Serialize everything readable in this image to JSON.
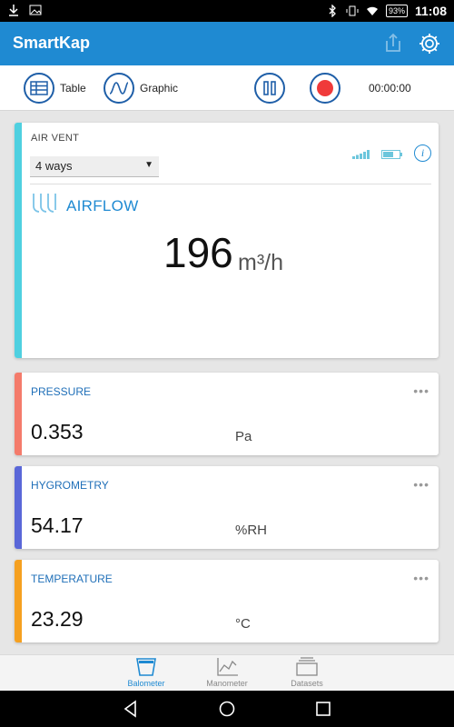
{
  "status_bar": {
    "battery": "93%",
    "time": "11:08"
  },
  "app": {
    "title": "SmartKap"
  },
  "toolbar": {
    "table_label": "Table",
    "graphic_label": "Graphic",
    "timer": "00:00:00"
  },
  "main_card": {
    "label": "AIR VENT",
    "selected_option": "4 ways",
    "measure_label": "AIRFLOW",
    "value": "196",
    "unit": "m³/h",
    "accent_color": "#4fd0e0"
  },
  "sensors": [
    {
      "title": "PRESSURE",
      "value": "0.353",
      "unit": "Pa",
      "accent_color": "#f47b6b"
    },
    {
      "title": "HYGROMETRY",
      "value": "54.17",
      "unit": "%RH",
      "accent_color": "#5a67d8"
    },
    {
      "title": "TEMPERATURE",
      "value": "23.29",
      "unit": "°C",
      "accent_color": "#f5a020"
    }
  ],
  "bottom_nav": {
    "items": [
      {
        "label": "Balometer",
        "icon": "balometer-icon"
      },
      {
        "label": "Manometer",
        "icon": "manometer-icon"
      },
      {
        "label": "Datasets",
        "icon": "datasets-icon"
      }
    ],
    "active": "Balometer"
  },
  "colors": {
    "primary": "#1f8ad2",
    "record": "#f03a3a"
  }
}
